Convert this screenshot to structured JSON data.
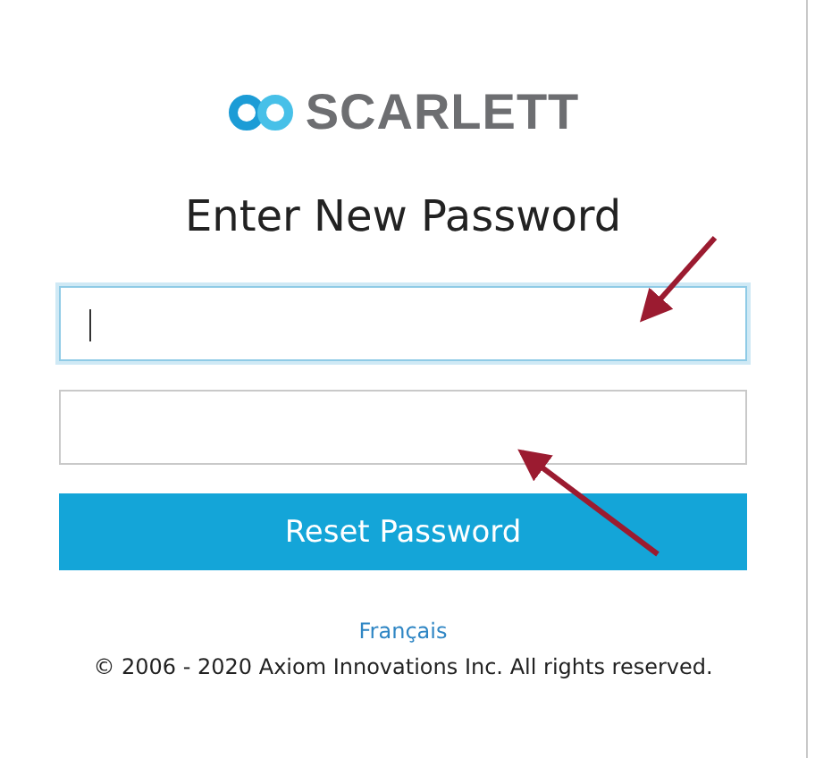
{
  "logo": {
    "name": "SCARLETT"
  },
  "title": "Enter New Password",
  "fields": [
    {
      "focused": true
    },
    {
      "focused": false
    }
  ],
  "button": "Reset Password",
  "language_link": "Français",
  "copyright": "© 2006 - 2020 Axiom Innovations Inc. All rights reserved.",
  "annotations": [
    {
      "kind": "arrow"
    },
    {
      "kind": "arrow"
    }
  ]
}
